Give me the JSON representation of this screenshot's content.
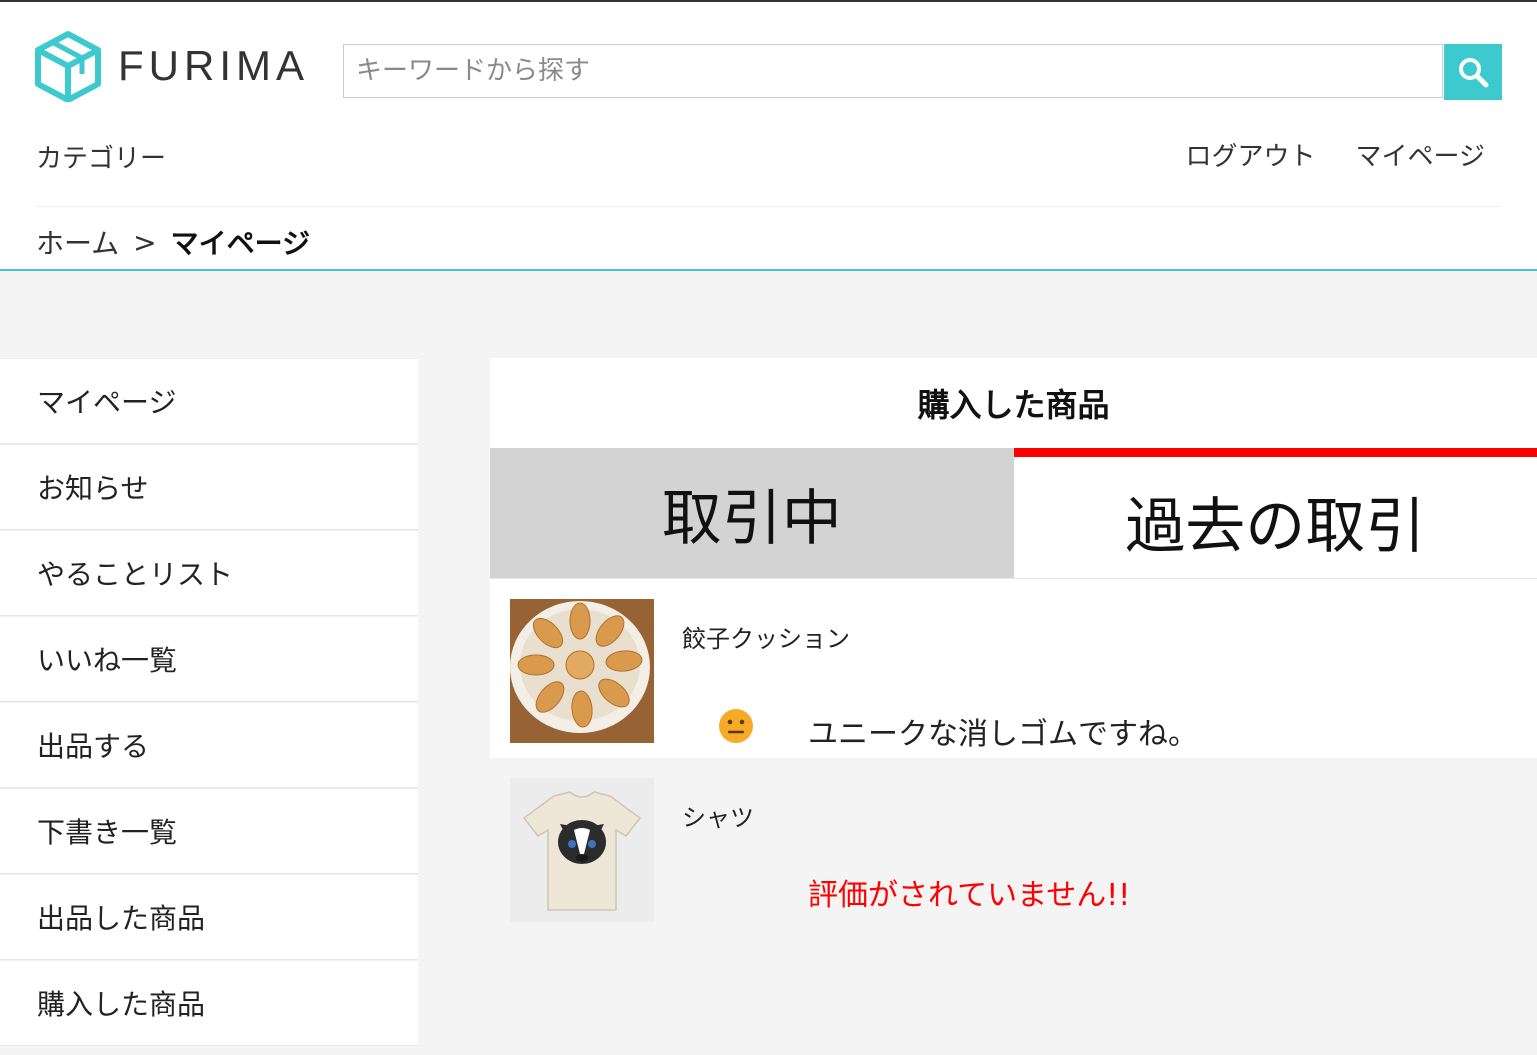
{
  "header": {
    "logo_text": "FURIMA",
    "search_placeholder": "キーワードから探す",
    "category_label": "カテゴリー",
    "logout_label": "ログアウト",
    "mypage_label": "マイページ"
  },
  "breadcrumb": {
    "home": "ホーム",
    "separator": ">",
    "current": "マイページ"
  },
  "sidebar": {
    "items": [
      {
        "label": "マイページ"
      },
      {
        "label": "お知らせ"
      },
      {
        "label": "やることリスト"
      },
      {
        "label": "いいね一覧"
      },
      {
        "label": "出品する"
      },
      {
        "label": "下書き一覧"
      },
      {
        "label": "出品した商品"
      },
      {
        "label": "購入した商品"
      }
    ]
  },
  "main": {
    "title": "購入した商品",
    "tabs": [
      {
        "label": "取引中"
      },
      {
        "label": "過去の取引"
      }
    ],
    "items": [
      {
        "name": "餃子クッション",
        "review": "ユニークな消しゴムですね。",
        "thumb_icon": "gyoza-plate-image",
        "status_icon": "neutral-face-icon"
      },
      {
        "name": "シャツ",
        "warning": "評価がされていません!!",
        "thumb_icon": "dog-tshirt-image"
      }
    ]
  },
  "colors": {
    "accent": "#3ccace",
    "tab_active_bg": "#d3d3d3",
    "tab_indicator": "#ff0000",
    "warning_text": "#ff0000",
    "neutral_face": "#f7a928"
  }
}
